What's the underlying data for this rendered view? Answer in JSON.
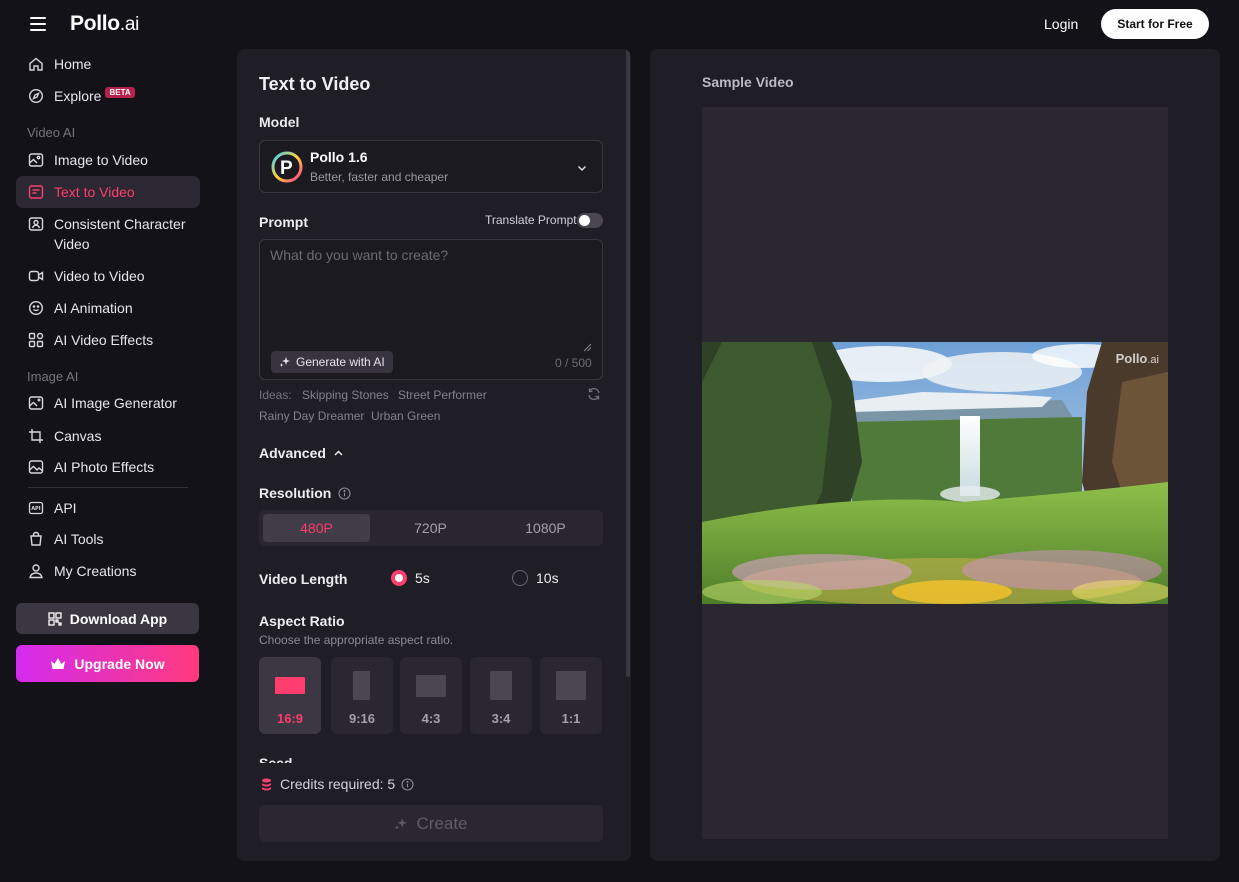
{
  "header": {
    "logo_main": "Pollo",
    "logo_suffix": ".ai",
    "login_label": "Login",
    "start_label": "Start for Free"
  },
  "sidebar": {
    "home": "Home",
    "explore": "Explore",
    "beta_badge": "BETA",
    "section_video": "Video AI",
    "image_to_video": "Image to Video",
    "text_to_video": "Text to Video",
    "consistent_line1": "Consistent Character",
    "consistent_line2": "Video",
    "video_to_video": "Video to Video",
    "ai_animation": "AI Animation",
    "ai_video_effects": "AI Video Effects",
    "section_image": "Image AI",
    "ai_image_generator": "AI Image Generator",
    "canvas": "Canvas",
    "ai_photo_effects": "AI Photo Effects",
    "api": "API",
    "ai_tools": "AI Tools",
    "my_creations": "My Creations",
    "download_app": "Download App",
    "upgrade_now": "Upgrade Now"
  },
  "form": {
    "title": "Text to Video",
    "model_label": "Model",
    "model_name": "Pollo 1.6",
    "model_desc": "Better, faster and cheaper",
    "prompt_label": "Prompt",
    "translate_label": "Translate Prompt",
    "translate_on": false,
    "prompt_placeholder": "What do you want to create?",
    "prompt_value": "",
    "generate_ai_label": "Generate with AI",
    "counter": "0 / 500",
    "ideas_label": "Ideas:",
    "ideas": [
      "Skipping Stones",
      "Street Performer",
      "Rainy Day Dreamer",
      "Urban Green"
    ],
    "advanced_label": "Advanced",
    "resolution_label": "Resolution",
    "resolutions": [
      "480P",
      "720P",
      "1080P"
    ],
    "resolution_selected": "480P",
    "video_length_label": "Video Length",
    "lengths": [
      "5s",
      "10s"
    ],
    "length_selected": "5s",
    "aspect_label": "Aspect Ratio",
    "aspect_sub": "Choose the appropriate aspect ratio.",
    "aspects": [
      "16:9",
      "9:16",
      "4:3",
      "3:4",
      "1:1"
    ],
    "aspect_selected": "16:9",
    "next_section_peek": "Seed",
    "credits_text": "Credits required: 5",
    "create_label": "Create"
  },
  "preview": {
    "title": "Sample Video",
    "watermark_main": "Pollo",
    "watermark_suffix": ".ai"
  },
  "colors": {
    "accent": "#ff3d6e",
    "upgrade_gradient_start": "#d42bf0",
    "upgrade_gradient_end": "#ff3a7c",
    "background": "#141219",
    "panel": "#1f1d25"
  }
}
